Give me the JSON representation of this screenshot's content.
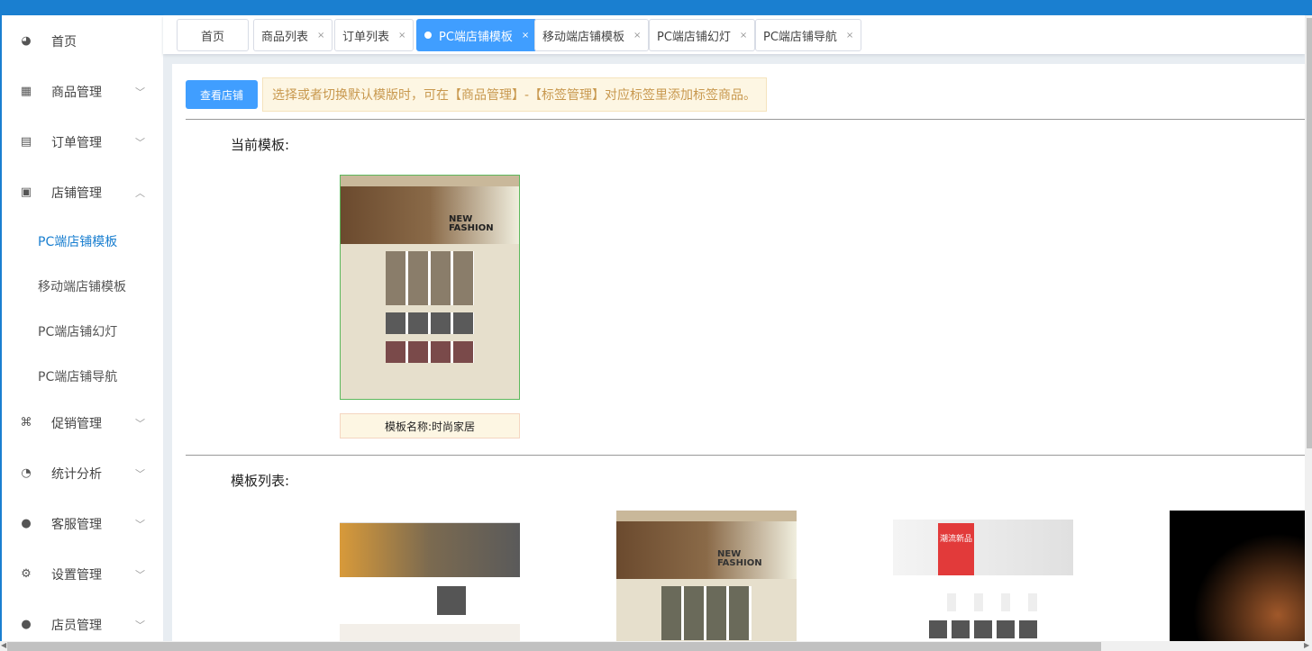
{
  "sidebar": {
    "items": [
      {
        "label": "首页",
        "icon": "dashboard-icon"
      },
      {
        "label": "商品管理",
        "icon": "grid-icon"
      },
      {
        "label": "订单管理",
        "icon": "clipboard-icon"
      },
      {
        "label": "店铺管理",
        "icon": "store-icon"
      },
      {
        "label": "促销管理",
        "icon": "tag-icon"
      },
      {
        "label": "统计分析",
        "icon": "pie-chart-icon"
      },
      {
        "label": "客服管理",
        "icon": "user-icon"
      },
      {
        "label": "设置管理",
        "icon": "gear-icon"
      },
      {
        "label": "店员管理",
        "icon": "users-icon"
      }
    ],
    "submenu": [
      "PC端店铺模板",
      "移动端店铺模板",
      "PC端店铺幻灯",
      "PC端店铺导航"
    ]
  },
  "tabs": [
    {
      "label": "首页"
    },
    {
      "label": "商品列表"
    },
    {
      "label": "订单列表"
    },
    {
      "label": "PC端店铺模板"
    },
    {
      "label": "移动端店铺模板"
    },
    {
      "label": "PC端店铺幻灯"
    },
    {
      "label": "PC端店铺导航"
    }
  ],
  "tab_close": "×",
  "main": {
    "view_shop": "查看店铺",
    "notice": "选择或者切换默认模版时，可在【商品管理】-【标签管理】对应标签里添加标签商品。",
    "current_title": "当前模板:",
    "current_name": "模板名称:时尚家居",
    "current_banner": "NEW FASHION",
    "list_title": "模板列表:",
    "list_banners": [
      "",
      "NEW FASHION",
      "潮流新品",
      ""
    ]
  },
  "colors": {
    "accent": "#409eff",
    "topbar": "#1a7fd0"
  }
}
